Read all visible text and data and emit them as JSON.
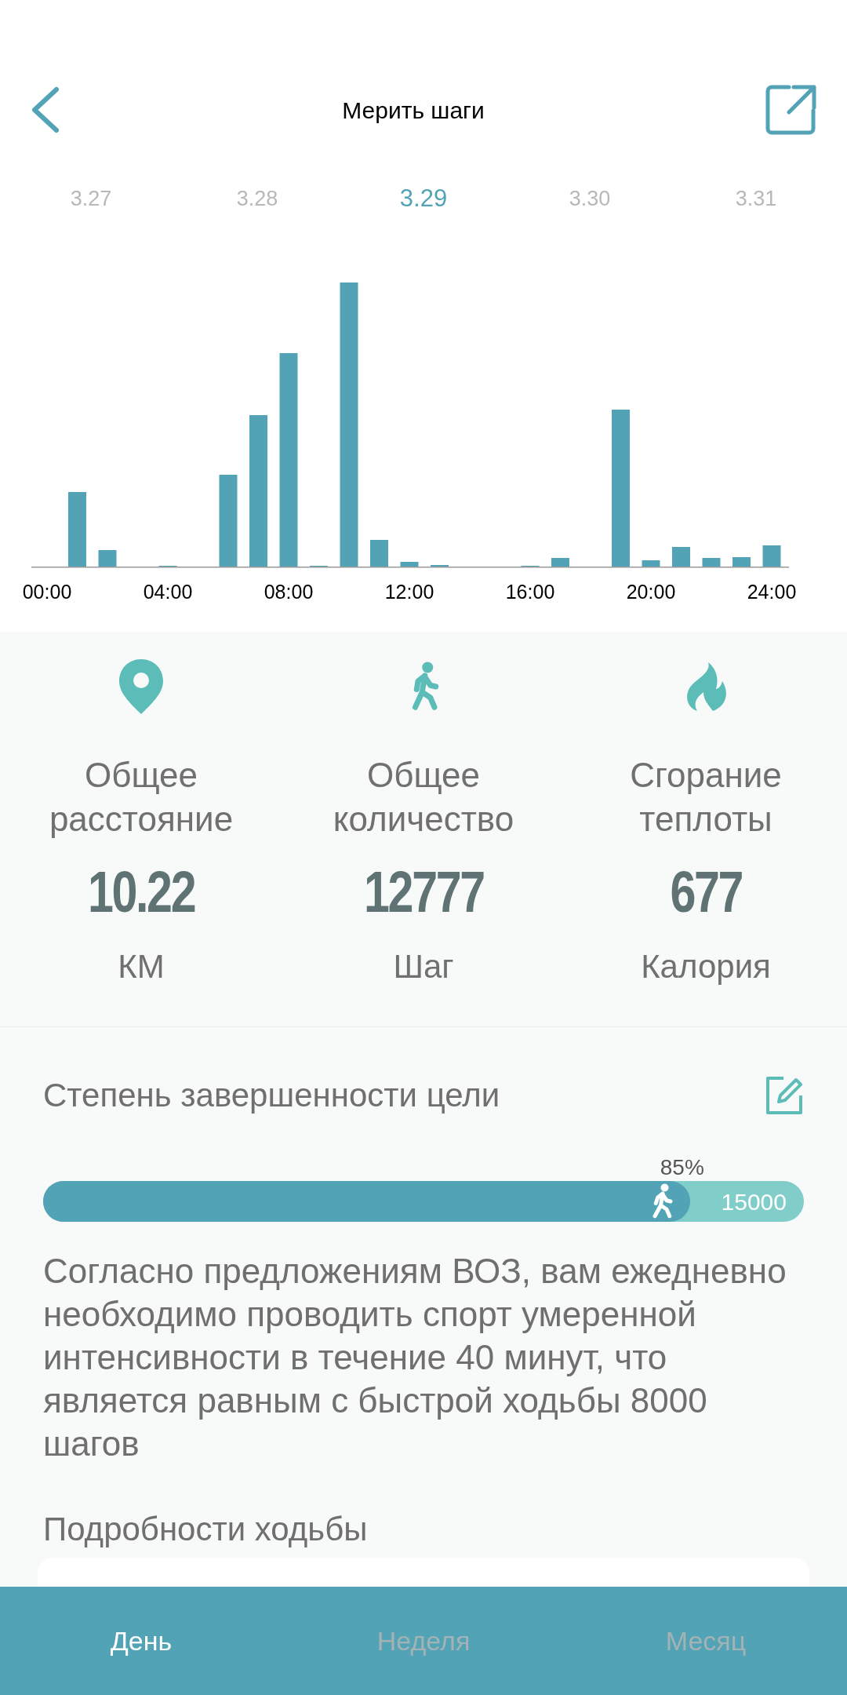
{
  "header": {
    "title": "Мерить шаги"
  },
  "dates": [
    {
      "label": "3.27",
      "selected": false
    },
    {
      "label": "3.28",
      "selected": false
    },
    {
      "label": "3.29",
      "selected": true
    },
    {
      "label": "3.30",
      "selected": false
    },
    {
      "label": "3.31",
      "selected": false
    }
  ],
  "chart": {
    "x_labels": [
      "00:00",
      "04:00",
      "08:00",
      "12:00",
      "16:00",
      "20:00",
      "24:00"
    ]
  },
  "stats": [
    {
      "kind": "distance",
      "label": "Общее расстояние",
      "value": "10.22",
      "unit": "КМ"
    },
    {
      "kind": "steps",
      "label": "Общее количество",
      "value": "12777",
      "unit": "Шаг"
    },
    {
      "kind": "calories",
      "label": "Сгорание теплоты",
      "value": "677",
      "unit": "Калория"
    }
  ],
  "goal": {
    "title": "Степень завершенности цели",
    "percent": "85%",
    "level": 0.85,
    "target": "15000",
    "note": "Согласно предложениям ВОЗ, вам ежедневно необходимо проводить спорт умеренной интенсивности в течение 40 минут, что является равным с быстрой ходьбы 8000 шагов"
  },
  "details": {
    "title": "Подробности ходьбы"
  },
  "tabs": [
    {
      "label": "День",
      "selected": true
    },
    {
      "label": "Неделя",
      "selected": false
    },
    {
      "label": "Месяц",
      "selected": false
    }
  ]
}
